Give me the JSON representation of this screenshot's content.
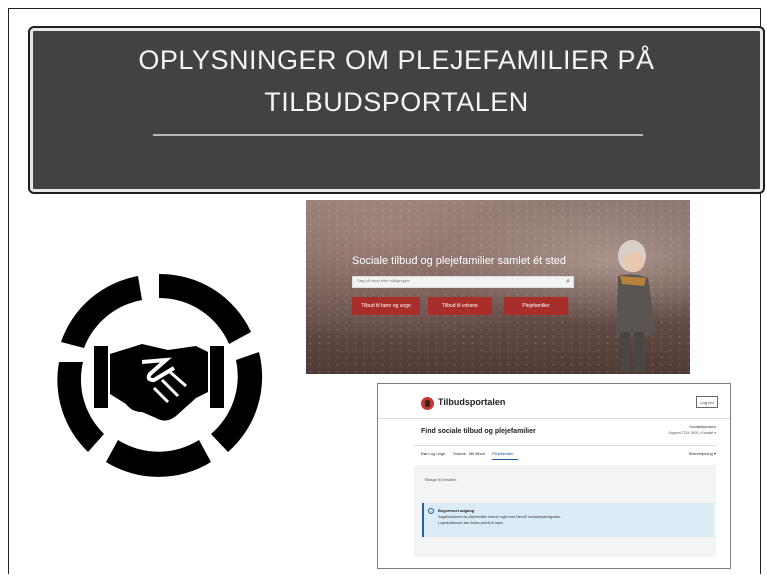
{
  "slide": {
    "title_line1": "OPLYSNINGER OM PLEJEFAMILIER PÅ",
    "title_line2": "TILBUDSPORTALEN"
  },
  "hero": {
    "heading": "Sociale tilbud og plejefamilier samlet ét sted",
    "search_placeholder": "Søg på navn eller måltgruppe",
    "search_icon": "search-icon",
    "buttons": [
      "Tilbud til børn og unge",
      "Tilbud til voksne",
      "Plejefamilier"
    ]
  },
  "portal": {
    "brand": "Tilbudsportalen",
    "login": "Log ind",
    "page_title": "Find sociale tilbud og plejefamilier",
    "owner": "Socialstyrelsen",
    "support": "Support 7224 1500 • Kontakt ▾",
    "nav": [
      "Børn og unge",
      "Voksne",
      "Mit tilbud",
      "Plejefamilier"
    ],
    "settings": "Sidebetjening ▾",
    "back_link": "Tilbage til forsiden",
    "info_title": "Begrænset adgang",
    "info_text1": "Søgefunktionen for plejefamilier kræver login med NemID medarbejdersignatur.",
    "info_text2": "Loginfunktionen kan findes øverst til højre."
  },
  "colors": {
    "title_bg": "#424242",
    "accent_red": "#a82e2a",
    "link_blue": "#1f5fa8",
    "info_bg": "#dcecf7"
  },
  "icons": [
    "handshake-icon",
    "search-icon",
    "info-icon",
    "tilbudsportalen-logo"
  ]
}
